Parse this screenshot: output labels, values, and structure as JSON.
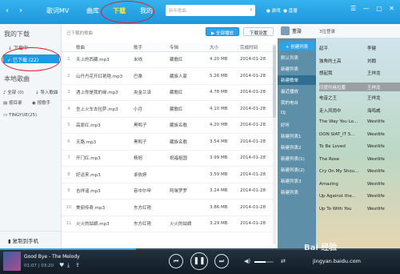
{
  "topbar": {
    "back": "‹",
    "forward": "›",
    "nav": [
      "歌词MV",
      "曲库",
      "下载",
      "我的"
    ],
    "active_nav": "下载",
    "search_placeholder": "新年歌曲",
    "game": "游戏",
    "app2": "直播",
    "win_buttons": "☰ — ▢ ✕"
  },
  "sidebar": {
    "my_downloads": "我的下载",
    "downloading": "下载中",
    "downloaded": "已下载 (22)",
    "local_songs": "本地歌曲",
    "all": "全部 (0)",
    "import": "导入歌曲",
    "by_dir": "按目录",
    "by_singer": "按歌手",
    "folder": "TINGYUE(25)",
    "copy_phone": "复制到手机",
    "new_badge": "NEW"
  },
  "main": {
    "crumb": "已下载的歌曲",
    "play_all": "全部播放",
    "settings": "下载设置",
    "columns": [
      "歌曲",
      "歌手",
      "专辑",
      "大小",
      "完成时间"
    ],
    "rows": [
      {
        "n": "1",
        "song": "天上的西藏.mp3",
        "singer": "米线",
        "album": "藏歌红",
        "size": "4.20 MB",
        "date": "2014-01-28"
      },
      {
        "n": "2",
        "song": "山丹丹花开红艳艳.mp3",
        "singer": "巴桑",
        "album": "藏族人家",
        "size": "5.26 MB",
        "date": "2014-01-28"
      },
      {
        "n": "3",
        "song": "遇上你是我的缘.mp3",
        "singer": "央金兰泽",
        "album": "藏歌红",
        "size": "4.78 MB",
        "date": "2014-01-28"
      },
      {
        "n": "4",
        "song": "坐上火车去拉萨.mp3",
        "singer": "小月",
        "album": "藏歌红",
        "size": "4.10 MB",
        "date": "2014-01-28"
      },
      {
        "n": "5",
        "song": "高原红.mp3",
        "singer": "黑鸭子",
        "album": "藏族名歌",
        "size": "4.20 MB",
        "date": "2014-01-28"
      },
      {
        "n": "6",
        "song": "天路.mp3",
        "singer": "黑鸭子",
        "album": "藏族名歌",
        "size": "3.54 MB",
        "date": "2014-01-28"
      },
      {
        "n": "7",
        "song": "开门红.mp3",
        "singer": "杨旭",
        "album": "祝福祖国",
        "size": "3.99 MB",
        "date": "2014-01-28"
      },
      {
        "n": "8",
        "song": "好运来.mp3",
        "singer": "卓依婷",
        "album": "",
        "size": "3.59 MB",
        "date": "2014-01-28"
      },
      {
        "n": "9",
        "song": "吉祥谣.mp3",
        "singer": "容中尔甲",
        "album": "阿咪罗罗",
        "size": "3.24 MB",
        "date": "2014-01-28"
      },
      {
        "n": "10",
        "song": "美丽传奇.mp3",
        "singer": "东方红艳",
        "album": "",
        "size": "3.86 MB",
        "date": "2014-01-28"
      },
      {
        "n": "11",
        "song": "火火的姑娘.mp3",
        "singer": "东方红艳",
        "album": "火火的姑娘",
        "size": "3.29 MB",
        "date": "2014-01-28"
      }
    ]
  },
  "right": {
    "user": "董璇",
    "sub": "3位登录",
    "new_list": "+ 创建列表",
    "playlists": [
      "默认列表",
      "新建列表",
      "新建歌单",
      "最近播放",
      "我的电台",
      "DJ",
      "好听",
      "新建列表1",
      "新建列表2",
      "新建列表(1)",
      "新建列表(2)",
      "新建列表3",
      "新建列表"
    ],
    "active_playlist": "新建歌单",
    "songs": [
      {
        "t": "起平",
        "a": "李健"
      },
      {
        "t": "独角的土高",
        "a": "刘翰"
      },
      {
        "t": "想起我",
        "a": "王祥龙"
      },
      {
        "t": "印度托格拉腊",
        "a": "王祥龙"
      },
      {
        "t": "电音之王",
        "a": "王祥龙"
      },
      {
        "t": "走入风雨中",
        "a": "海鸣威"
      },
      {
        "t": "The Way You Lo…",
        "a": "Westlife"
      },
      {
        "t": "DON SIAT_IT S…",
        "a": "Westlife"
      },
      {
        "t": "To Be Loved",
        "a": "Westlife"
      },
      {
        "t": "The Rose",
        "a": "Westlife"
      },
      {
        "t": "Cry On My Shou…",
        "a": "Westlife"
      },
      {
        "t": "Amazing",
        "a": "Westlife"
      },
      {
        "t": "Up Against the…",
        "a": "Westlife"
      },
      {
        "t": "Up To With You",
        "a": "Westlife"
      }
    ],
    "active_song": "印度托格拉腊"
  },
  "player": {
    "title": "Good Bye - The Melody",
    "time": "01:07 | 03:20",
    "progress": 0.34,
    "volume": 0.6,
    "watermark": "Bai 经验",
    "watermark2": "jingyan.baidu.com"
  }
}
